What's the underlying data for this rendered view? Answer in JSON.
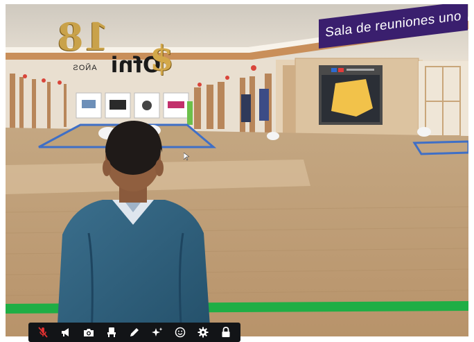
{
  "room_sign": {
    "text": "Sala de reuniones uno"
  },
  "logo": {
    "years_text": "18",
    "anos_text": "AÑOS",
    "brand_text": "Ofni",
    "dollar_text": "$"
  },
  "toolbar": {
    "buttons": [
      {
        "icon": "mic-muted-icon"
      },
      {
        "icon": "megaphone-icon"
      },
      {
        "icon": "camera-icon"
      },
      {
        "icon": "seat-icon"
      },
      {
        "icon": "pencil-icon"
      },
      {
        "icon": "sparkle-icon"
      },
      {
        "icon": "emoji-icon"
      },
      {
        "icon": "gear-icon"
      },
      {
        "icon": "lock-icon"
      }
    ]
  },
  "colors": {
    "toolbar_bg": "#121417",
    "mic_muted": "#e03030",
    "room_sign_bg": "#3a1f6e",
    "floor_stripe": "#1fae45",
    "floor": "#c9ab86",
    "rug_border": "#3f6fc6"
  }
}
